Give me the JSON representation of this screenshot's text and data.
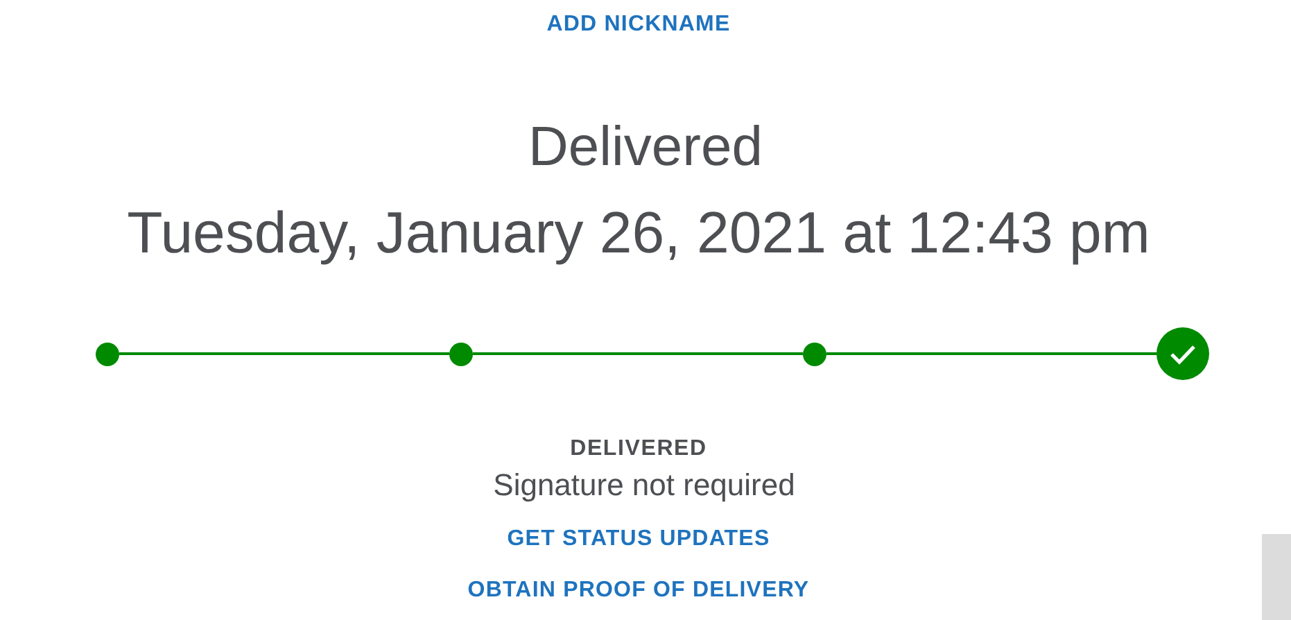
{
  "nickname_link": "ADD NICKNAME",
  "status_title": "Delivered",
  "delivery_datetime": "Tuesday, January 26, 2021 at 12:43 pm",
  "progress_steps": [
    {
      "completed": true,
      "current": false
    },
    {
      "completed": true,
      "current": false
    },
    {
      "completed": true,
      "current": false
    },
    {
      "completed": true,
      "current": true
    }
  ],
  "status_label": "DELIVERED",
  "status_detail": "Signature not required",
  "links": [
    "GET STATUS UPDATES",
    "OBTAIN PROOF OF DELIVERY"
  ]
}
